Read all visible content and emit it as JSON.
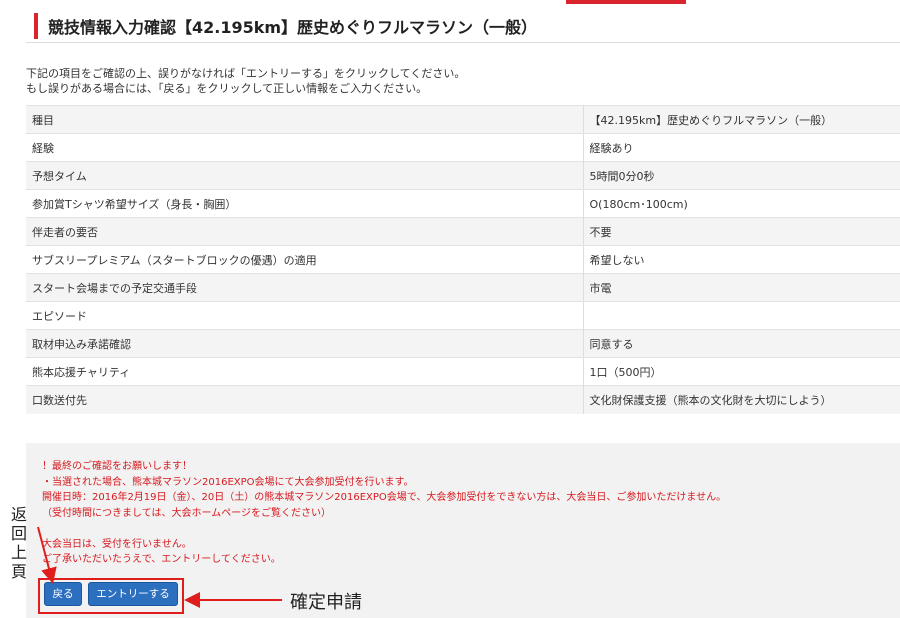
{
  "header": {
    "title": "競技情報入力確認【42.195km】歴史めぐりフルマラソン（一般）"
  },
  "intro": {
    "line1": "下記の項目をご確認の上、誤りがなければ「エントリーする」をクリックしてください。",
    "line2": "もし誤りがある場合には、「戻る」をクリックして正しい情報をご入力ください。"
  },
  "table": {
    "rows": [
      {
        "label": "種目",
        "value": "【42.195km】歴史めぐりフルマラソン（一般）"
      },
      {
        "label": "経験",
        "value": "経験あり"
      },
      {
        "label": "予想タイム",
        "value": "5時間0分0秒"
      },
      {
        "label": "参加賞Tシャツ希望サイズ（身長・胸囲）",
        "value": "O(180cm･100cm)"
      },
      {
        "label": "伴走者の要否",
        "value": "不要"
      },
      {
        "label": "サブスリープレミアム（スタートブロックの優遇）の適用",
        "value": "希望しない"
      },
      {
        "label": "スタート会場までの予定交通手段",
        "value": "市電"
      },
      {
        "label": "エピソード",
        "value": ""
      },
      {
        "label": "取材申込み承諾確認",
        "value": "同意する"
      },
      {
        "label": "熊本応援チャリティ",
        "value": "1口（500円）"
      },
      {
        "label": "口数送付先",
        "value": "文化財保護支援（熊本の文化財を大切にしよう）"
      }
    ]
  },
  "notice": {
    "lines": [
      "！最終のご確認をお願いします！",
      "・当選された場合、熊本城マラソン2016EXPO会場にて大会参加受付を行います。",
      "開催日時：2016年2月19日（金）、20日（土）の熊本城マラソン2016EXPO会場で、大会参加受付をできない方は、大会当日、ご参加いただけません。",
      "（受付時間につきましては、大会ホームページをご覧ください）",
      "",
      "大会当日は、受付を行いません。",
      "ご了承いただいたうえで、エントリーしてください。"
    ]
  },
  "buttons": {
    "back_label": "戻る",
    "entry_label": "エントリーする"
  },
  "annotations": {
    "left_label": "返回上頁",
    "right_label": "確定申請"
  },
  "colors": {
    "accent": "#d9232d",
    "button": "#2d6fbf",
    "notice_text": "#d7191f"
  }
}
